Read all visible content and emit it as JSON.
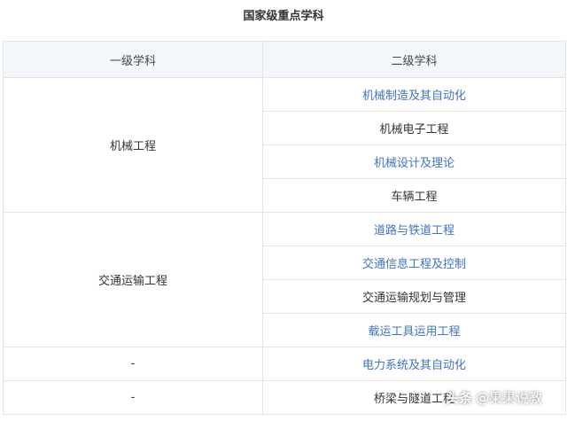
{
  "title": "国家级重点学科",
  "headers": {
    "col1": "一级学科",
    "col2": "二级学科"
  },
  "groups": [
    {
      "first": "机械工程",
      "subs": [
        {
          "text": "机械制造及其自动化",
          "link": true
        },
        {
          "text": "机械电子工程",
          "link": false
        },
        {
          "text": "机械设计及理论",
          "link": true
        },
        {
          "text": "车辆工程",
          "link": false
        }
      ]
    },
    {
      "first": "交通运输工程",
      "subs": [
        {
          "text": "道路与铁道工程",
          "link": true
        },
        {
          "text": "交通信息工程及控制",
          "link": true
        },
        {
          "text": "交通运输规划与管理",
          "link": false
        },
        {
          "text": "载运工具运用工程",
          "link": true
        }
      ]
    },
    {
      "first": "-",
      "subs": [
        {
          "text": "电力系统及其自动化",
          "link": true
        }
      ]
    },
    {
      "first": "-",
      "subs": [
        {
          "text": "桥梁与隧道工程",
          "link": false
        }
      ]
    }
  ],
  "watermark": {
    "logo": "头条",
    "text": "@果果说教"
  },
  "colors": {
    "link": "#3f72c6",
    "header_bg": "#f3f6fa",
    "border": "#e3e3e3"
  }
}
